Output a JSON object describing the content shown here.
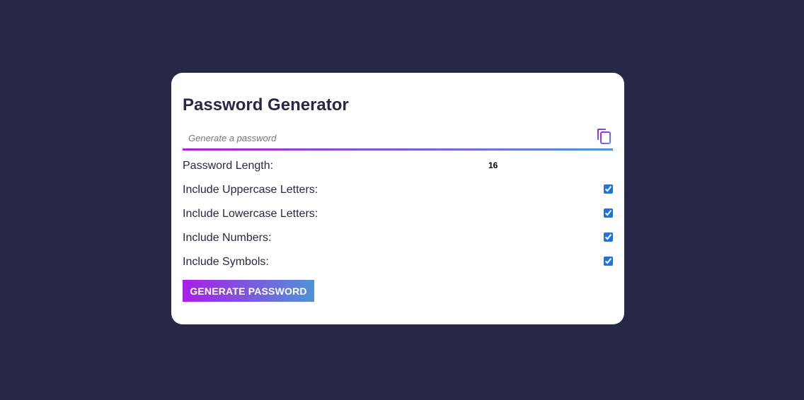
{
  "title": "Password Generator",
  "password": {
    "placeholder": "Generate a password",
    "value": "",
    "copy_icon": "copy-icon"
  },
  "length": {
    "label": "Password Length:",
    "value": "16"
  },
  "options": [
    {
      "label": "Include Uppercase Letters:",
      "checked": true
    },
    {
      "label": "Include Lowercase Letters:",
      "checked": true
    },
    {
      "label": "Include Numbers:",
      "checked": true
    },
    {
      "label": "Include Symbols:",
      "checked": true
    }
  ],
  "generate_button": "GENERATE PASSWORD",
  "colors": {
    "background": "#272846",
    "card": "#ffffff",
    "gradient_start": "#a91ee6",
    "gradient_end": "#4f93d6",
    "text": "#272846"
  }
}
